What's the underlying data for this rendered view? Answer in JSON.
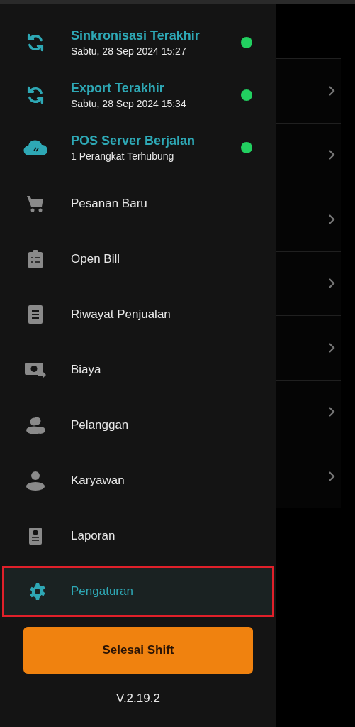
{
  "status_items": [
    {
      "title": "Sinkronisasi Terakhir",
      "subtitle": "Sabtu, 28 Sep 2024 15:27",
      "connected": true
    },
    {
      "title": "Export Terakhir",
      "subtitle": "Sabtu, 28 Sep 2024 15:34",
      "connected": true
    },
    {
      "title": "POS Server Berjalan",
      "subtitle": "1 Perangkat Terhubung",
      "connected": true
    }
  ],
  "menu_items": [
    {
      "label": "Pesanan Baru",
      "selected": false,
      "highlighted": false
    },
    {
      "label": "Open Bill",
      "selected": false,
      "highlighted": false
    },
    {
      "label": "Riwayat Penjualan",
      "selected": false,
      "highlighted": false
    },
    {
      "label": "Biaya",
      "selected": false,
      "highlighted": false
    },
    {
      "label": "Pelanggan",
      "selected": false,
      "highlighted": false
    },
    {
      "label": "Karyawan",
      "selected": false,
      "highlighted": false
    },
    {
      "label": "Laporan",
      "selected": false,
      "highlighted": false
    },
    {
      "label": "Pengaturan",
      "selected": true,
      "highlighted": true
    }
  ],
  "end_shift_button": "Selesai Shift",
  "version": "V.2.19.2",
  "background_rows": [
    {
      "chevron": true
    },
    {
      "chevron": true
    },
    {
      "chevron": true
    },
    {
      "chevron": true
    },
    {
      "chevron": true
    },
    {
      "chevron": true
    },
    {
      "chevron": true
    }
  ]
}
